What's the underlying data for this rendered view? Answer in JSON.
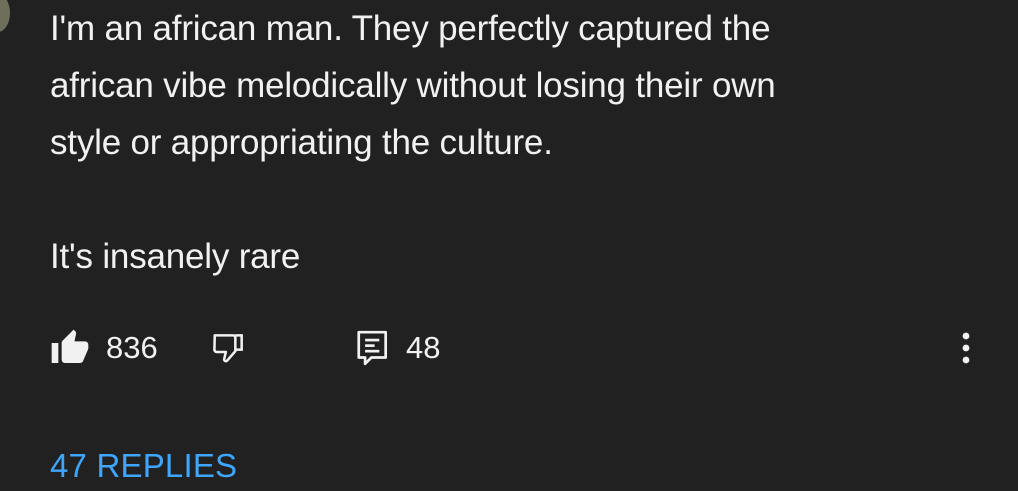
{
  "comment": {
    "line1": "I'm an african man. They perfectly captured the",
    "line2": "african vibe melodically without losing their own",
    "line3": "style or appropriating the culture.",
    "line4": "It's insanely rare"
  },
  "actions": {
    "like_icon": "thumb-up-filled-icon",
    "like_count": "836",
    "dislike_icon": "thumb-down-outline-icon",
    "reply_icon": "comment-icon",
    "reply_count": "48",
    "more_icon": "more-vertical-icon"
  },
  "replies": {
    "label": "47 REPLIES"
  },
  "colors": {
    "background": "#212121",
    "text": "#f1f1f1",
    "link": "#3ea6ff"
  }
}
